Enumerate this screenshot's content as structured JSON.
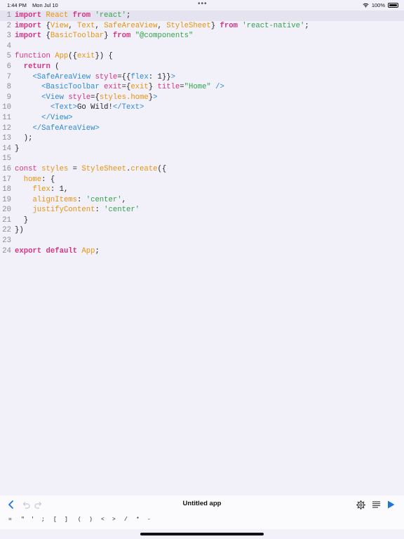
{
  "status": {
    "time": "1:44 PM",
    "date": "Mon Jul 10",
    "dots": "•••",
    "battery": "100%"
  },
  "code_lines": [
    {
      "n": "1",
      "active": true,
      "tokens": [
        [
          "kw",
          "import"
        ],
        [
          "pl",
          " "
        ],
        [
          "fn",
          "React"
        ],
        [
          "pl",
          " "
        ],
        [
          "kw",
          "from"
        ],
        [
          "pl",
          " "
        ],
        [
          "str",
          "'react'"
        ],
        [
          "pl",
          ";"
        ]
      ]
    },
    {
      "n": "2",
      "tokens": [
        [
          "kw",
          "import"
        ],
        [
          "pl",
          " {"
        ],
        [
          "fn",
          "View"
        ],
        [
          "pl",
          ", "
        ],
        [
          "fn",
          "Text"
        ],
        [
          "pl",
          ", "
        ],
        [
          "fn",
          "SafeAreaView"
        ],
        [
          "pl",
          ", "
        ],
        [
          "fn",
          "StyleSheet"
        ],
        [
          "pl",
          "} "
        ],
        [
          "kw",
          "from"
        ],
        [
          "pl",
          " "
        ],
        [
          "str",
          "'react-native'"
        ],
        [
          "pl",
          ";"
        ]
      ]
    },
    {
      "n": "3",
      "tokens": [
        [
          "kw",
          "import"
        ],
        [
          "pl",
          " {"
        ],
        [
          "fn",
          "BasicToolbar"
        ],
        [
          "pl",
          "} "
        ],
        [
          "kw",
          "from"
        ],
        [
          "pl",
          " "
        ],
        [
          "str",
          "\"@components\""
        ]
      ]
    },
    {
      "n": "4",
      "tokens": []
    },
    {
      "n": "5",
      "tokens": [
        [
          "attr",
          "function"
        ],
        [
          "pl",
          " "
        ],
        [
          "fn",
          "App"
        ],
        [
          "pl",
          "({"
        ],
        [
          "fn",
          "exit"
        ],
        [
          "pl",
          "}) {"
        ]
      ]
    },
    {
      "n": "6",
      "tokens": [
        [
          "pl",
          "  "
        ],
        [
          "kw",
          "return"
        ],
        [
          "pl",
          " ("
        ]
      ]
    },
    {
      "n": "7",
      "tokens": [
        [
          "pl",
          "    "
        ],
        [
          "tag",
          "<SafeAreaView"
        ],
        [
          "pl",
          " "
        ],
        [
          "attr",
          "style"
        ],
        [
          "pl",
          "={{"
        ],
        [
          "tag",
          "flex"
        ],
        [
          "pl",
          ": "
        ],
        [
          "num",
          "1"
        ],
        [
          "pl",
          "}}"
        ],
        [
          "tag",
          ">"
        ]
      ]
    },
    {
      "n": "8",
      "tokens": [
        [
          "pl",
          "      "
        ],
        [
          "tag",
          "<BasicToolbar"
        ],
        [
          "pl",
          " "
        ],
        [
          "attr",
          "exit"
        ],
        [
          "pl",
          "={"
        ],
        [
          "fn",
          "exit"
        ],
        [
          "pl",
          "} "
        ],
        [
          "attr",
          "title"
        ],
        [
          "pl",
          "="
        ],
        [
          "str",
          "\"Home\""
        ],
        [
          "pl",
          " "
        ],
        [
          "tag",
          "/>"
        ]
      ]
    },
    {
      "n": "9",
      "tokens": [
        [
          "pl",
          "      "
        ],
        [
          "tag",
          "<View"
        ],
        [
          "pl",
          " "
        ],
        [
          "attr",
          "style"
        ],
        [
          "pl",
          "={"
        ],
        [
          "fn",
          "styles.home"
        ],
        [
          "pl",
          "}"
        ],
        [
          "tag",
          ">"
        ]
      ]
    },
    {
      "n": "10",
      "tokens": [
        [
          "pl",
          "        "
        ],
        [
          "tag",
          "<Text>"
        ],
        [
          "pl",
          "Go Wild!"
        ],
        [
          "tag",
          "</Text>"
        ]
      ]
    },
    {
      "n": "11",
      "tokens": [
        [
          "pl",
          "      "
        ],
        [
          "tag",
          "</View>"
        ]
      ]
    },
    {
      "n": "12",
      "tokens": [
        [
          "pl",
          "    "
        ],
        [
          "tag",
          "</SafeAreaView>"
        ]
      ]
    },
    {
      "n": "13",
      "tokens": [
        [
          "pl",
          "  );"
        ]
      ]
    },
    {
      "n": "14",
      "tokens": [
        [
          "pl",
          "}"
        ]
      ]
    },
    {
      "n": "15",
      "tokens": []
    },
    {
      "n": "16",
      "tokens": [
        [
          "attr",
          "const"
        ],
        [
          "pl",
          " "
        ],
        [
          "fn",
          "styles"
        ],
        [
          "pl",
          " = "
        ],
        [
          "fn",
          "StyleSheet"
        ],
        [
          "pl",
          "."
        ],
        [
          "fn",
          "create"
        ],
        [
          "pl",
          "({"
        ]
      ]
    },
    {
      "n": "17",
      "tokens": [
        [
          "pl",
          "  "
        ],
        [
          "fn",
          "home"
        ],
        [
          "pl",
          ": {"
        ]
      ]
    },
    {
      "n": "18",
      "tokens": [
        [
          "pl",
          "    "
        ],
        [
          "fn",
          "flex"
        ],
        [
          "pl",
          ": "
        ],
        [
          "num",
          "1"
        ],
        [
          "pl",
          ","
        ]
      ]
    },
    {
      "n": "19",
      "tokens": [
        [
          "pl",
          "    "
        ],
        [
          "fn",
          "alignItems"
        ],
        [
          "pl",
          ": "
        ],
        [
          "str",
          "'center'"
        ],
        [
          "pl",
          ","
        ]
      ]
    },
    {
      "n": "20",
      "tokens": [
        [
          "pl",
          "    "
        ],
        [
          "fn",
          "justifyContent"
        ],
        [
          "pl",
          ": "
        ],
        [
          "str",
          "'center'"
        ]
      ]
    },
    {
      "n": "21",
      "tokens": [
        [
          "pl",
          "  }"
        ]
      ]
    },
    {
      "n": "22",
      "tokens": [
        [
          "pl",
          "})"
        ]
      ]
    },
    {
      "n": "23",
      "tokens": []
    },
    {
      "n": "24",
      "tokens": [
        [
          "kw",
          "export"
        ],
        [
          "pl",
          " "
        ],
        [
          "kw",
          "default"
        ],
        [
          "pl",
          " "
        ],
        [
          "fn",
          "App"
        ],
        [
          "pl",
          ";"
        ]
      ]
    }
  ],
  "toolbar": {
    "title": "Untitled app",
    "back_icon": "chevron-left-icon",
    "undo_icon": "undo-icon",
    "redo_icon": "redo-icon",
    "settings_icon": "gear-icon",
    "list_icon": "list-icon",
    "run_icon": "play-icon"
  },
  "keys": [
    "=",
    "\"",
    "'",
    ";",
    "[",
    "]",
    "(",
    ")",
    "<",
    ">",
    "/",
    "*",
    "-"
  ],
  "colors": {
    "accent": "#1f74e0",
    "keyword": "#d63384",
    "identifier": "#e8930c",
    "string": "#2fa34a",
    "tag": "#2c8ad6"
  }
}
